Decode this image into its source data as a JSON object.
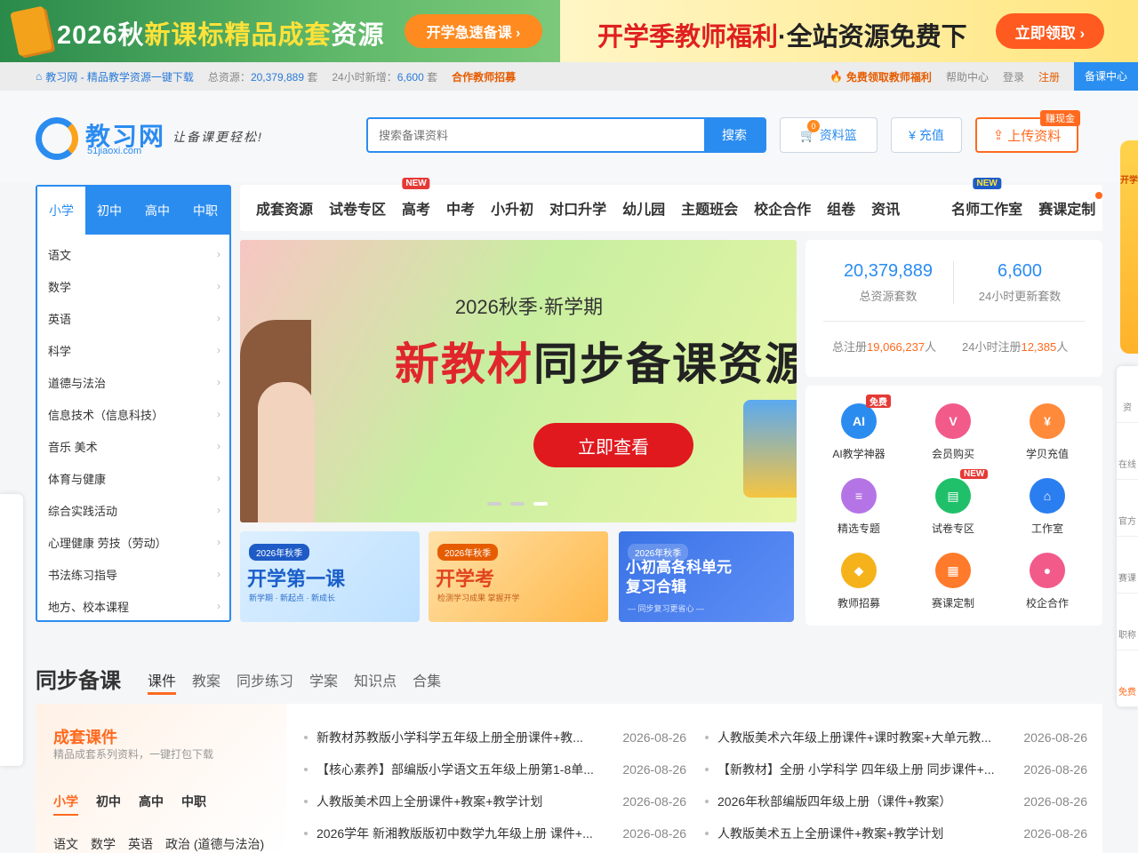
{
  "banner": {
    "left_title_a": "2026秋",
    "left_title_b": "新课标精品成套",
    "left_title_c": "资源",
    "left_btn": "开学急速备课 ›",
    "right_title_a": "开学季教师福利",
    "right_title_b": "·全站资源免费下",
    "right_btn": "立即领取 ›"
  },
  "topbar": {
    "home": "教习网 - 精品教学资源一键下载",
    "total_label": "总资源：",
    "total_value": "20,379,889",
    "total_unit": "套",
    "new_label": "24小时新增：",
    "new_value": "6,600",
    "new_unit": "套",
    "recruit": "合作教师招募",
    "free_benefit": "免费领取教师福利",
    "help": "帮助中心",
    "login": "登录",
    "register": "注册",
    "center": "备课中心"
  },
  "header": {
    "logo_text": "教习网",
    "logo_domain": "51jiaoxi.com",
    "slogan": "让备课更轻松!",
    "search_placeholder": "搜索备课资料",
    "search_btn": "搜索",
    "basket": "资料篮",
    "basket_count": "0",
    "charge": "充值",
    "upload": "上传资料",
    "earn": "赚现金"
  },
  "category": {
    "tabs": [
      "小学",
      "初中",
      "高中",
      "中职"
    ],
    "items": [
      "语文",
      "数学",
      "英语",
      "科学",
      "道德与法治",
      "信息技术（信息科技）",
      "音乐  美术",
      "体育与健康",
      "综合实践活动",
      "心理健康  劳技（劳动）",
      "书法练习指导",
      "地方、校本课程"
    ]
  },
  "nav": {
    "items": [
      "成套资源",
      "试卷专区",
      "高考",
      "中考",
      "小升初",
      "对口升学",
      "幼儿园",
      "主题班会",
      "校企合作",
      "组卷",
      "资讯",
      "名师工作室",
      "赛课定制"
    ],
    "tag_new": "NEW"
  },
  "hero": {
    "subtitle": "2026秋季·新学期",
    "title_red": "新教材",
    "title_black": "同步备课资源",
    "cta": "立即查看"
  },
  "promos": [
    {
      "tag": "2026年秋季",
      "title": "开学第一课",
      "sub": "新学期 · 新起点 · 新成长"
    },
    {
      "tag": "2026年秋季",
      "title": "开学考",
      "sub": "检测学习成果  掌握开学"
    },
    {
      "tag": "2026年秋季",
      "title": "小初高各科单元复习合辑",
      "sub": "— 同步复习更省心 —"
    }
  ],
  "stats": {
    "total": "20,379,889",
    "total_label": "总资源套数",
    "daily": "6,600",
    "daily_label": "24小时更新套数",
    "reg_label": "总注册",
    "reg_value": "19,066,237",
    "reg_unit": "人",
    "reg24_label": "24小时注册",
    "reg24_value": "12,385",
    "reg24_unit": "人"
  },
  "tools": [
    {
      "label": "AI教学神器",
      "badge": "免费",
      "color": "#2b8cf0",
      "icon": "ai-icon"
    },
    {
      "label": "会员购买",
      "badge": "",
      "color": "#f25a8a",
      "icon": "vip-icon"
    },
    {
      "label": "学贝充值",
      "badge": "",
      "color": "#ff8a3a",
      "icon": "coin-icon"
    },
    {
      "label": "精选专题",
      "badge": "",
      "color": "#b574e6",
      "icon": "topic-icon"
    },
    {
      "label": "试卷专区",
      "badge": "NEW",
      "color": "#20c06a",
      "icon": "exam-icon"
    },
    {
      "label": "工作室",
      "badge": "",
      "color": "#2b7ef0",
      "icon": "house-icon"
    },
    {
      "label": "教师招募",
      "badge": "",
      "color": "#f5b21b",
      "icon": "grad-cap-icon"
    },
    {
      "label": "赛课定制",
      "badge": "",
      "color": "#ff7a2a",
      "icon": "contest-icon"
    },
    {
      "label": "校企合作",
      "badge": "",
      "color": "#f25a8a",
      "icon": "team-icon"
    }
  ],
  "side": [
    "资",
    "在线",
    "官方",
    "赛课",
    "职称",
    "免费"
  ],
  "float_ad": "开学",
  "section": {
    "title": "同步备课",
    "tabs": [
      "课件",
      "教案",
      "同步练习",
      "学案",
      "知识点",
      "合集"
    ],
    "set_title": "成套课件",
    "set_sub": "精品成套系列资料，一键打包下载",
    "set_tabs": [
      "小学",
      "初中",
      "高中",
      "中职"
    ],
    "set_subs": [
      "语文",
      "数学",
      "英语",
      "政治 (道德与法治)"
    ],
    "left_list": [
      {
        "title": "新教材苏教版小学科学五年级上册全册课件+教...",
        "date": "2026-08-26"
      },
      {
        "title": "【核心素养】部编版小学语文五年级上册第1-8单...",
        "date": "2026-08-26"
      },
      {
        "title": "人教版美术四上全册课件+教案+教学计划",
        "date": "2026-08-26"
      },
      {
        "title": "2026学年 新湘教版版初中数学九年级上册 课件+...",
        "date": "2026-08-26"
      }
    ],
    "right_list": [
      {
        "title": "人教版美术六年级上册课件+课时教案+大单元教...",
        "date": "2026-08-26"
      },
      {
        "title": "【新教材】全册 小学科学 四年级上册 同步课件+...",
        "date": "2026-08-26"
      },
      {
        "title": "2026年秋部编版四年级上册（课件+教案）",
        "date": "2026-08-26"
      },
      {
        "title": "人教版美术五上全册课件+教案+教学计划",
        "date": "2026-08-26"
      }
    ]
  }
}
